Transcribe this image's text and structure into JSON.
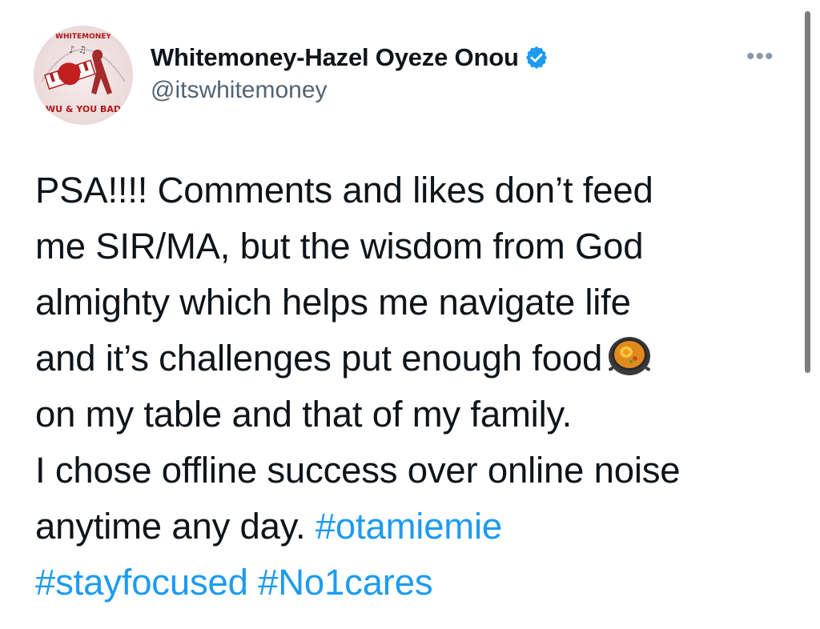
{
  "author": {
    "display_name": "Whitemoney-Hazel Oyeze Onou",
    "handle": "@itswhitemoney",
    "verified": true,
    "verified_color": "#1d9bf0",
    "avatar_text_top": "WHITEMONEY",
    "avatar_text_bottom": "WU & YOU BAD"
  },
  "menu": {
    "more_label": "•••"
  },
  "tweet": {
    "lines": [
      "PSA!!!! Comments and likes don’t feed",
      "me SIR/MA, but the wisdom from God",
      "almighty which helps me navigate life",
      "and it’s challenges put enough food",
      "on my table and that of my family.",
      "I chose offline success over online noise",
      "anytime any day. "
    ],
    "emoji": "shallow-pan-of-food-icon",
    "hashtags": [
      "#otamiemie",
      "#stayfocused",
      "#No1cares"
    ]
  },
  "colors": {
    "text": "#0f1419",
    "secondary": "#536471",
    "link": "#1d9bf0"
  }
}
